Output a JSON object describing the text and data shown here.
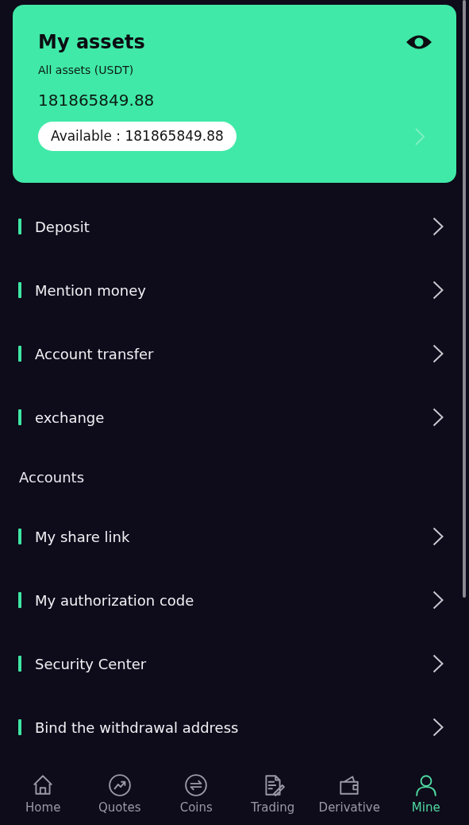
{
  "assets_card": {
    "title": "My assets",
    "subtitle": "All assets (USDT)",
    "total": "181865849.88",
    "available": "Available : 181865849.88"
  },
  "menu": [
    {
      "kind": "item",
      "label": "Deposit"
    },
    {
      "kind": "item",
      "label": "Mention money"
    },
    {
      "kind": "item",
      "label": "Account transfer"
    },
    {
      "kind": "item",
      "label": "exchange"
    },
    {
      "kind": "heading",
      "label": "Accounts"
    },
    {
      "kind": "item",
      "label": "My share link"
    },
    {
      "kind": "item",
      "label": "My authorization code"
    },
    {
      "kind": "item",
      "label": "Security Center"
    },
    {
      "kind": "item",
      "label": "Bind the withdrawal address"
    }
  ],
  "bottom_nav": [
    {
      "label": "Home",
      "selected": false
    },
    {
      "label": "Quotes",
      "selected": false
    },
    {
      "label": "Coins",
      "selected": false
    },
    {
      "label": "Trading",
      "selected": false
    },
    {
      "label": "Derivative",
      "selected": false
    },
    {
      "label": "Mine",
      "selected": true
    }
  ]
}
